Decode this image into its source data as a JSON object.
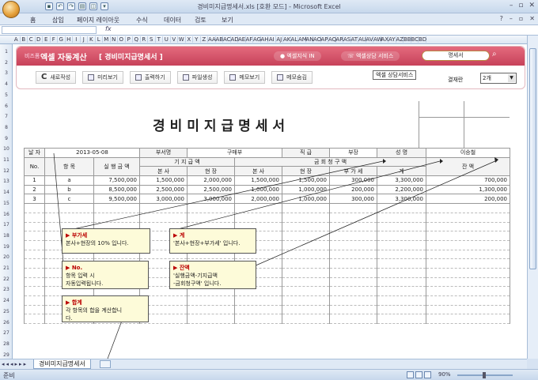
{
  "window": {
    "title": "경비미지급명세서.xls  [호환 모드] - Microsoft Excel"
  },
  "ribbon_tabs": [
    "홈",
    "삽입",
    "페이지 레이아웃",
    "수식",
    "데이터",
    "검토",
    "보기"
  ],
  "formula_bar": {
    "fx": "fx"
  },
  "column_headers": [
    "A",
    "B",
    "C",
    "D",
    "E",
    "F",
    "G",
    "H",
    "I",
    "J",
    "K",
    "L",
    "M",
    "N",
    "O",
    "P",
    "Q",
    "R",
    "S",
    "T",
    "U",
    "V",
    "W",
    "X",
    "Y",
    "Z",
    "AA",
    "AB",
    "AC",
    "AD",
    "AE",
    "AF",
    "AG",
    "AH",
    "AI",
    "AJ",
    "AK",
    "AL",
    "AM",
    "AN",
    "AO",
    "AP",
    "AQ",
    "AR",
    "AS",
    "AT",
    "AU",
    "AV",
    "AW",
    "AX",
    "AY",
    "AZ",
    "BB",
    "BC",
    "BD"
  ],
  "row_headers": [
    "1",
    "2",
    "3",
    "4",
    "5",
    "6",
    "7",
    "8",
    "9",
    "10",
    "11",
    "12",
    "13",
    "14",
    "15",
    "16",
    "17",
    "18",
    "19",
    "20",
    "21",
    "22",
    "23",
    "24",
    "25",
    "26",
    "27",
    "28",
    "29"
  ],
  "banner": {
    "small": "비즈폼",
    "brand": "엑셀 자동계산",
    "subtitle": "[ 경비미지급명세서 ]",
    "link1": "엑셀지식 IN",
    "link2": "엑셀상담 서비스",
    "search_value": "명세서",
    "tooltip": "엑셀 상담서비스"
  },
  "toolbar": {
    "new": "새로작성",
    "preview": "미리보기",
    "print": "출력하기",
    "file": "파일생성",
    "memo_show": "메모보기",
    "memo_hide": "메모숨김",
    "approver_label": "결재란",
    "approver_value": "2개"
  },
  "form": {
    "title": "경비미지급명세서",
    "date_label": "날  자",
    "date_value": "2013-05-08",
    "dept_label": "부서명",
    "dept_value": "구매부",
    "rank_label": "직  급",
    "rank_value": "부장",
    "name_label": "성  명",
    "name_value": "이승철",
    "headers": {
      "no": "No.",
      "item": "항      목",
      "exec": "실 행 금 액",
      "paid": "기  지  급  액",
      "paid_hq": "본  사",
      "paid_site": "현  장",
      "claim": "금  회  청  구  액",
      "claim_hq": "본  사",
      "claim_site": "현  장",
      "claim_vat": "부 가 세",
      "claim_total": "계",
      "balance": "잔      액"
    },
    "rows": [
      {
        "no": "1",
        "item": "a",
        "exec": "7,500,000",
        "paid_hq": "1,500,000",
        "paid_site": "2,000,000",
        "claim_hq": "1,500,000",
        "claim_site": "1,500,000",
        "vat": "300,000",
        "total": "3,300,000",
        "balance": "700,000"
      },
      {
        "no": "2",
        "item": "b",
        "exec": "8,500,000",
        "paid_hq": "2,500,000",
        "paid_site": "2,500,000",
        "claim_hq": "1,000,000",
        "claim_site": "1,000,000",
        "vat": "200,000",
        "total": "2,200,000",
        "balance": "1,300,000"
      },
      {
        "no": "3",
        "item": "c",
        "exec": "9,500,000",
        "paid_hq": "3,000,000",
        "paid_site": "3,000,000",
        "claim_hq": "2,000,000",
        "claim_site": "1,000,000",
        "vat": "300,000",
        "total": "3,300,000",
        "balance": "200,000"
      }
    ]
  },
  "notes": {
    "n1_title": "▶ 부가세",
    "n1_body": "본사+현장의 10% 입니다.",
    "n2_title": "▶ 계",
    "n2_body": "'본사+현장+부가세' 입니다.",
    "n3_title": "▶ No.",
    "n3_body1": "항목 입력 시",
    "n3_body2": "자동입력됩니다.",
    "n4_title": "▶ 잔액",
    "n4_body1": "'실행금액-기지급액",
    "n4_body2": "-금회청구액' 입니다.",
    "n5_title": "▶ 합계",
    "n5_body1": "각 항목의 합을 계산합니",
    "n5_body2": "다."
  },
  "sheet_tab": "경비미지급명세서",
  "status": {
    "ready": "준비",
    "zoom": "90%"
  }
}
